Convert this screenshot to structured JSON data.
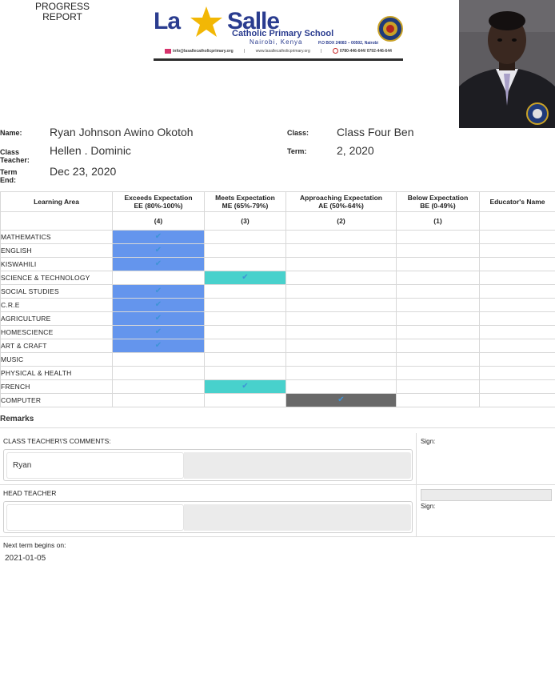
{
  "header": {
    "title_line1": "PROGRESS",
    "title_line2": "REPORT"
  },
  "school": {
    "brand_part1": "La",
    "brand_part2": "Salle",
    "name": "Catholic Primary School",
    "location": "Nairobi, Kenya",
    "po_box": "P.O BOX 24083 – 00502, Nairobi",
    "email": "info@lasallecatholicprimary.org",
    "website": "www.lasallecatholicprimary.org",
    "phone": "0780-446-644/ 0792-446-644",
    "brand_color": "#2a3c8f"
  },
  "student": {
    "name_label": "Name:",
    "name": "Ryan Johnson Awino Okotoh",
    "class_label": "Class:",
    "class": "Class Four Ben",
    "teacher_label_1": "Class",
    "teacher_label_2": "Teacher:",
    "teacher": "Hellen . Dominic",
    "term_label": "Term:",
    "term": "2, 2020",
    "term_end_label_1": "Term",
    "term_end_label_2": "End:",
    "term_end": "Dec 23, 2020"
  },
  "table": {
    "headers": {
      "area": "Learning Area",
      "ee_1": "Exceeds Expectation",
      "ee_2": "EE (80%-100%)",
      "me_1": "Meets Expectation",
      "me_2": "ME (65%-79%)",
      "ae_1": "Approaching Expectation",
      "ae_2": "AE (50%-64%)",
      "be_1": "Below Expectation",
      "be_2": "BE (0-49%)",
      "educator": "Educator's Name"
    },
    "scores": {
      "ee": "(4)",
      "me": "(3)",
      "ae": "(2)",
      "be": "(1)"
    },
    "check_mark": "✔",
    "colors": {
      "ee": "#6495ed",
      "me": "#48d1cc",
      "ae": "#696969",
      "check": "#3f93d6"
    },
    "rows": [
      {
        "subject": "MATHEMATICS",
        "level": "EE"
      },
      {
        "subject": "ENGLISH",
        "level": "EE"
      },
      {
        "subject": "KISWAHILI",
        "level": "EE"
      },
      {
        "subject": "SCIENCE & TECHNOLOGY",
        "level": "ME"
      },
      {
        "subject": "SOCIAL STUDIES",
        "level": "EE"
      },
      {
        "subject": "C.R.E",
        "level": "EE"
      },
      {
        "subject": "AGRICULTURE",
        "level": "EE"
      },
      {
        "subject": "HOMESCIENCE",
        "level": "EE"
      },
      {
        "subject": "ART & CRAFT",
        "level": "EE"
      },
      {
        "subject": "MUSIC",
        "level": ""
      },
      {
        "subject": "PHYSICAL & HEALTH",
        "level": ""
      },
      {
        "subject": "FRENCH",
        "level": "ME"
      },
      {
        "subject": "COMPUTER",
        "level": "AE"
      }
    ]
  },
  "remarks": {
    "title": "Remarks",
    "class_teacher_label": "CLASS TEACHER\\'S COMMENTS:",
    "class_teacher_comment": "Ryan",
    "head_teacher_label": "HEAD TEACHER",
    "head_teacher_comment": "",
    "sign_label": "Sign:",
    "next_term_label": "Next term begins on:",
    "next_term_date": "2021-01-05"
  }
}
